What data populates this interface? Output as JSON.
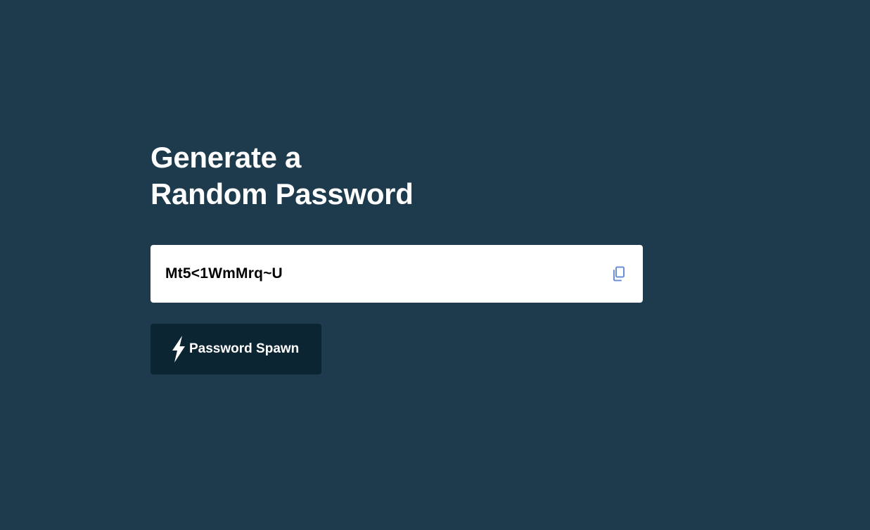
{
  "page": {
    "background_color": "#1d3b4d"
  },
  "header": {
    "title_line1": "Generate a",
    "title_line2": "Random Password"
  },
  "password": {
    "value": "Mt5<1WmMrq~U",
    "copy_icon": "copy-icon",
    "copy_icon_color": "#6b8fd6"
  },
  "generate_button": {
    "label": "Password Spawn",
    "icon": "lightning-bolt-icon",
    "background_color": "#0b2533"
  }
}
